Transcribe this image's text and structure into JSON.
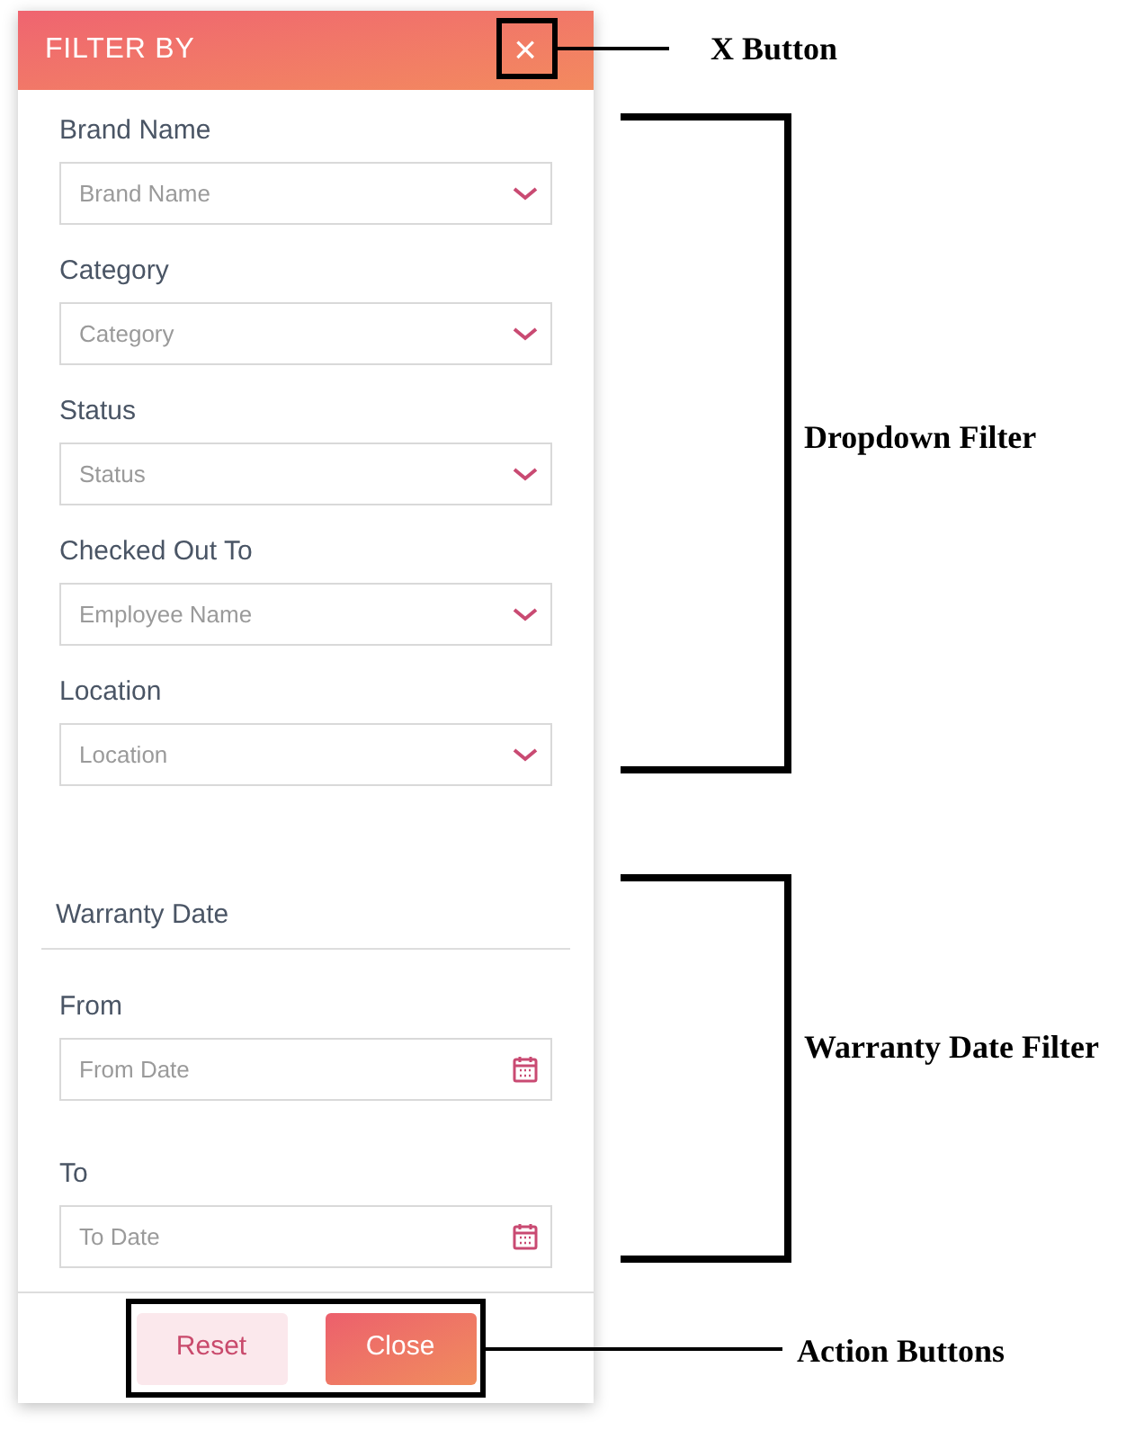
{
  "panel": {
    "title": "FILTER BY",
    "close_icon": "×",
    "dropdowns": [
      {
        "label": "Brand Name",
        "placeholder": "Brand Name"
      },
      {
        "label": "Category",
        "placeholder": "Category"
      },
      {
        "label": "Status",
        "placeholder": "Status"
      },
      {
        "label": "Checked Out To",
        "placeholder": "Employee Name"
      },
      {
        "label": "Location",
        "placeholder": "Location"
      }
    ],
    "date_section": {
      "title": "Warranty Date",
      "fields": [
        {
          "label": "From",
          "placeholder": "From Date"
        },
        {
          "label": "To",
          "placeholder": "To Date"
        }
      ]
    },
    "buttons": [
      {
        "label": "Reset",
        "kind": "secondary"
      },
      {
        "label": "Close",
        "kind": "primary"
      }
    ]
  },
  "annotations": [
    {
      "kind": "box",
      "label": "X Button"
    },
    {
      "kind": "bracket",
      "label": "Dropdown Filter"
    },
    {
      "kind": "bracket",
      "label": "Warranty Date Filter"
    },
    {
      "kind": "box",
      "label": "Action Buttons"
    }
  ]
}
